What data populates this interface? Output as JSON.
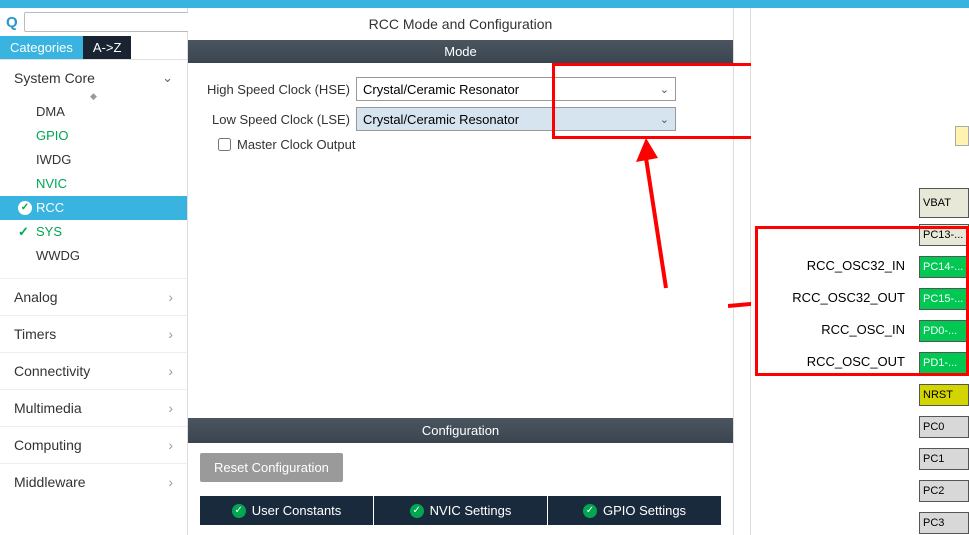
{
  "header": {
    "title": "RCC Mode and Configuration"
  },
  "sidebar": {
    "tabs": {
      "cat": "Categories",
      "az": "A->Z"
    },
    "system_core": "System Core",
    "items": [
      "DMA",
      "GPIO",
      "IWDG",
      "NVIC",
      "RCC",
      "SYS",
      "WWDG"
    ],
    "groups": [
      "Analog",
      "Timers",
      "Connectivity",
      "Multimedia",
      "Computing",
      "Middleware"
    ]
  },
  "mode": {
    "section": "Mode",
    "hse_label": "High Speed Clock (HSE)",
    "hse_value": "Crystal/Ceramic Resonator",
    "lse_label": "Low Speed Clock (LSE)",
    "lse_value": "Crystal/Ceramic Resonator",
    "mco_label": "Master Clock Output"
  },
  "config": {
    "section": "Configuration",
    "reset": "Reset Configuration",
    "tabs": [
      "User Constants",
      "NVIC Settings",
      "GPIO Settings"
    ]
  },
  "pins": {
    "labels": [
      "RCC_OSC32_IN",
      "RCC_OSC32_OUT",
      "RCC_OSC_IN",
      "RCC_OSC_OUT"
    ],
    "chips": {
      "vbat": "VBAT",
      "pc13": "PC13-...",
      "pc14": "PC14-...",
      "pc15": "PC15-...",
      "pd0": "PD0-...",
      "pd1": "PD1-...",
      "nrst": "NRST",
      "pc0": "PC0",
      "pc1": "PC1",
      "pc2": "PC2",
      "pc3": "PC3"
    }
  }
}
